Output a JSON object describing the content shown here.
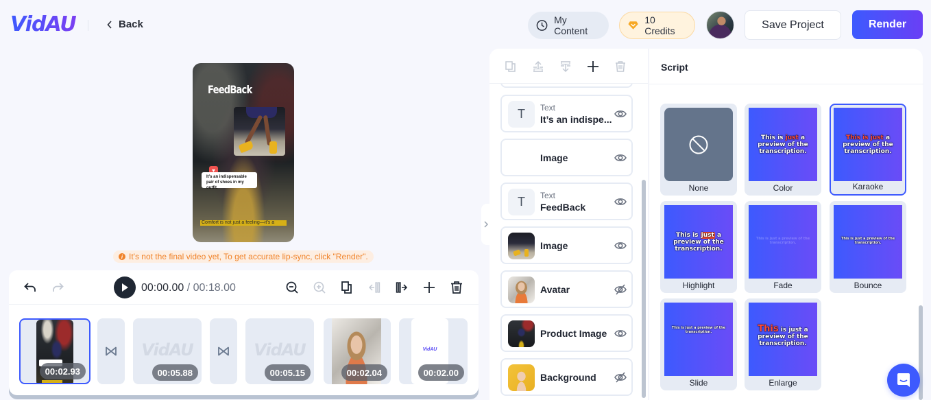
{
  "header": {
    "logo": "VidAU",
    "back_label": "Back",
    "my_content_label": "My Content",
    "credits_label": "10 Credits",
    "save_label": "Save Project",
    "render_label": "Render",
    "colors": {
      "accent": "#3d5afe",
      "accent_end": "#6a3ff5",
      "credits_bg": "#fff3de"
    }
  },
  "preview": {
    "title_overlay": "FeedBack",
    "bubble_text": "It’s an indispensable pair of shoes in my outfit.",
    "caption_text": "Comfort is not just a feeling—it’s a",
    "warning": "It's not the final video yet, To get accurate lip-sync, click \"Render\"."
  },
  "timeline": {
    "current_time": "00:00.00",
    "separator": " / ",
    "total_time": "00:18.00",
    "tools": [
      "undo-icon",
      "redo-icon",
      "zoom-out-icon",
      "zoom-in-icon",
      "duplicate-icon",
      "split-left-icon",
      "split-right-icon",
      "add-icon",
      "delete-icon"
    ],
    "clips": [
      {
        "kind": "scene",
        "duration": "00:02.93",
        "selected": true
      },
      {
        "kind": "transition"
      },
      {
        "kind": "placeholder",
        "watermark": "VidAU",
        "duration": "00:05.88"
      },
      {
        "kind": "transition"
      },
      {
        "kind": "placeholder",
        "watermark": "VidAU",
        "duration": "00:05.15"
      },
      {
        "kind": "avatar",
        "duration": "00:02.04"
      },
      {
        "kind": "outro",
        "watermark": "VidAU",
        "duration": "00:02.00"
      }
    ]
  },
  "layers": {
    "tools": [
      "duplicate-icon",
      "bring-forward-icon",
      "send-backward-icon",
      "add-icon",
      "delete-icon"
    ],
    "items": [
      {
        "kind": "Text",
        "name": "It’s an indispe...",
        "visible": true,
        "thumb": "T"
      },
      {
        "kind": "",
        "name": "Image",
        "visible": true,
        "thumb": ""
      },
      {
        "kind": "Text",
        "name": "FeedBack",
        "visible": true,
        "thumb": "T"
      },
      {
        "kind": "",
        "name": "Image",
        "visible": true,
        "thumb": "image"
      },
      {
        "kind": "",
        "name": "Avatar",
        "visible": false,
        "thumb": "avatar"
      },
      {
        "kind": "",
        "name": "Product Image",
        "visible": true,
        "thumb": "product"
      },
      {
        "kind": "",
        "name": "Background",
        "visible": false,
        "thumb": "background"
      }
    ]
  },
  "script": {
    "title": "Script",
    "preview_text_a": "This is",
    "preview_text_b": "just",
    "preview_text_c": "a preview of the transcription.",
    "preview_text_full": "This is just a preview of the transcription.",
    "enlarge_word": "This",
    "enlarge_rest": "is just a preview of the transcription.",
    "styles": [
      {
        "label": "None",
        "selected": false
      },
      {
        "label": "Color",
        "selected": false
      },
      {
        "label": "Karaoke",
        "selected": true
      },
      {
        "label": "Highlight",
        "selected": false
      },
      {
        "label": "Fade",
        "selected": false
      },
      {
        "label": "Bounce",
        "selected": false
      },
      {
        "label": "Slide",
        "selected": false
      },
      {
        "label": "Enlarge",
        "selected": false
      }
    ]
  }
}
